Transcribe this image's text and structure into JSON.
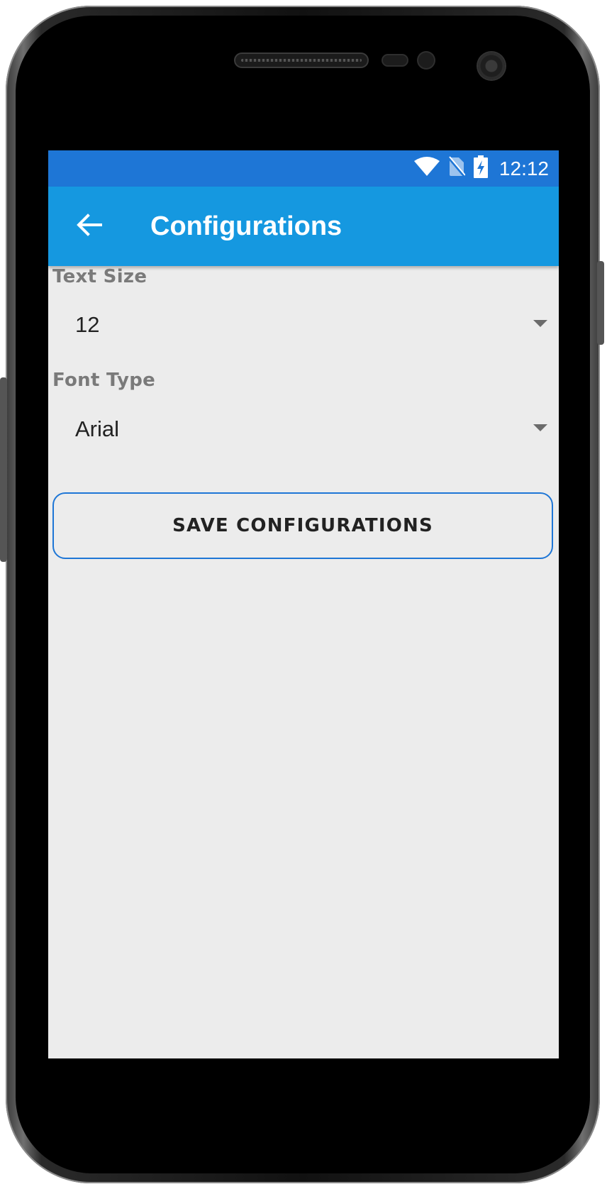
{
  "status_bar": {
    "time": "12:12",
    "icons": [
      "wifi-icon",
      "no-sim-icon",
      "battery-charging-icon"
    ]
  },
  "app_bar": {
    "back_icon": "arrow-left-icon",
    "title": "Configurations"
  },
  "form": {
    "text_size": {
      "label": "Text Size",
      "value": "12"
    },
    "font_type": {
      "label": "Font Type",
      "value": "Arial"
    },
    "save_button_label": "SAVE CONFIGURATIONS"
  },
  "colors": {
    "status_bar": "#1e76d6",
    "app_bar": "#1598e0",
    "background": "#ececec",
    "button_border": "#1e76d6"
  }
}
